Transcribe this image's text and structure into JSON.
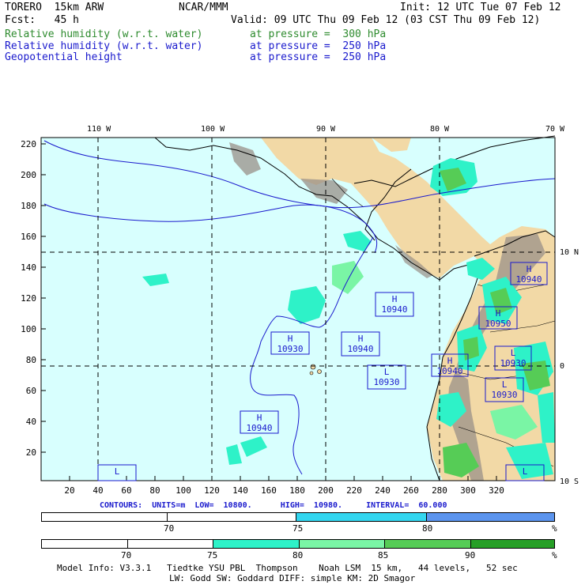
{
  "header": {
    "model": "TORERO  15km ARW",
    "org": "NCAR/MMM",
    "init": "Init: 12 UTC Tue 07 Feb 12",
    "fcst": "Fcst:   45 h",
    "valid": "Valid: 09 UTC Thu 09 Feb 12 (03 CST Thu 09 Feb 12)",
    "fields": [
      {
        "name": "Relative humidity (w.r.t. water)",
        "level": "at pressure =  300 hPa",
        "color": "#2e8b2e"
      },
      {
        "name": "Relative humidity (w.r.t. water)",
        "level": "at pressure =  250 hPa",
        "color": "#1a1acd"
      },
      {
        "name": "Geopotential height",
        "level": "at pressure =  250 hPa",
        "color": "#1a1acd"
      }
    ]
  },
  "map": {
    "lon_labels": [
      "110 W",
      "100 W",
      "90 W",
      "80 W",
      "70 W"
    ],
    "lat_labels": [
      "10 N",
      "0",
      "10 S"
    ],
    "x_ticks": [
      "20",
      "40",
      "60",
      "80",
      "100",
      "120",
      "140",
      "160",
      "180",
      "200",
      "220",
      "240",
      "260",
      "280",
      "300",
      "320"
    ],
    "y_ticks": [
      "20",
      "40",
      "60",
      "80",
      "100",
      "120",
      "140",
      "160",
      "180",
      "200",
      "220"
    ],
    "colors": {
      "ocean": "#d8fffe",
      "land": "#f2d9a6",
      "mountain": "#9a9088",
      "contour": "#1a1acd",
      "grid": "#000000"
    },
    "centers": [
      {
        "type": "H",
        "value": "10940"
      },
      {
        "type": "H",
        "value": "10950"
      },
      {
        "type": "H",
        "value": "10940"
      },
      {
        "type": "H",
        "value": "10930"
      },
      {
        "type": "H",
        "value": "10940"
      },
      {
        "type": "L",
        "value": "10930"
      },
      {
        "type": "H",
        "value": "10940"
      },
      {
        "type": "L",
        "value": "10930"
      },
      {
        "type": "L",
        "value": "10930"
      },
      {
        "type": "H",
        "value": "10940"
      },
      {
        "type": "L",
        "value": ""
      },
      {
        "type": "L",
        "value": ""
      }
    ]
  },
  "contours_info": "CONTOURS:  UNITS=m  LOW=  10800.      HIGH=  10980.     INTERVAL=  60.000",
  "colorbar_250": {
    "ticks": [
      "70",
      "75",
      "80"
    ],
    "unit": "%",
    "colors": [
      "#ffffff",
      "#ffffff",
      "#33d6f0",
      "#5b94ee"
    ]
  },
  "colorbar_300": {
    "ticks": [
      "70",
      "75",
      "80",
      "85",
      "90"
    ],
    "unit": "%",
    "colors": [
      "#ffffff",
      "#ffffff",
      "#ffffff",
      "#2ef2c8",
      "#7af5a5",
      "#56cc56",
      "#279f27"
    ]
  },
  "footer": {
    "line1": "Model Info: V3.3.1   Tiedtke YSU PBL  Thompson    Noah LSM  15 km,   44 levels,   52 sec",
    "line2": "LW: Godd SW: Goddard DIFF: simple KM: 2D Smagor"
  }
}
